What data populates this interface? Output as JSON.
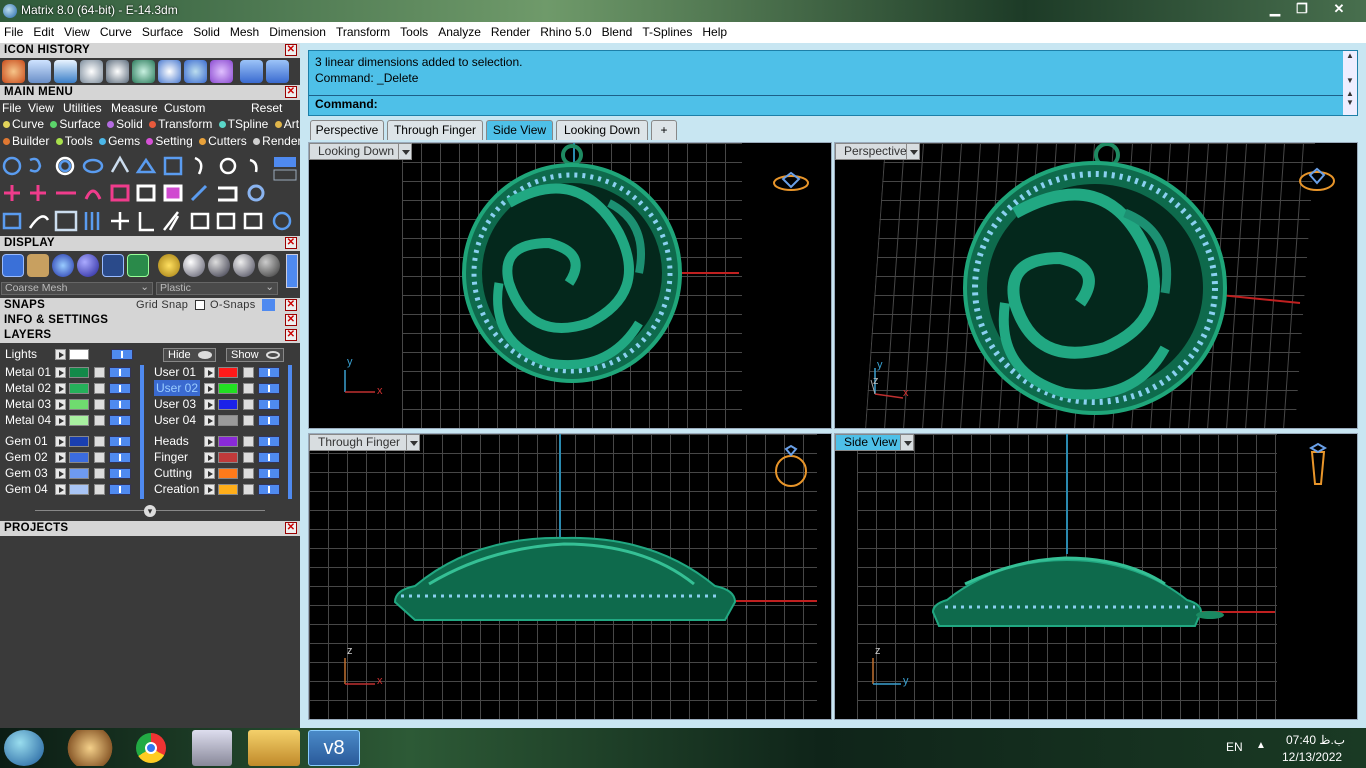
{
  "window": {
    "title": "Matrix 8.0 (64-bit) - E-14.3dm",
    "minimize": "▁",
    "maximize": "❐",
    "close": "✕"
  },
  "menu": [
    "File",
    "Edit",
    "View",
    "Curve",
    "Surface",
    "Solid",
    "Mesh",
    "Dimension",
    "Transform",
    "Tools",
    "Analyze",
    "Render",
    "Rhino 5.0",
    "Blend",
    "T-Splines",
    "Help"
  ],
  "panels": {
    "icon_history": "ICON HISTORY",
    "main_menu": "MAIN MENU",
    "main_menu_items": [
      "File",
      "View",
      "Utilities",
      "Measure",
      "Custom",
      "Reset"
    ],
    "categories_row1": [
      "Curve",
      "Surface",
      "Solid",
      "Transform",
      "TSpline",
      "Art"
    ],
    "categories_row2": [
      "Builder",
      "Tools",
      "Gems",
      "Setting",
      "Cutters",
      "Render"
    ],
    "category_colors": {
      "Curve": "#e3d35a",
      "Surface": "#5bd46a",
      "Solid": "#b36be0",
      "Transform": "#e85a3c",
      "TSpline": "#5ad6c8",
      "Art": "#e0b54a",
      "Builder": "#e07832",
      "Tools": "#a8e04c",
      "Gems": "#4cb7e8",
      "Setting": "#d652d6",
      "Cutters": "#e8a13a",
      "Render": "#d0d0d0"
    },
    "display": "DISPLAY",
    "display_mesh": "Coarse Mesh",
    "display_material": "Plastic",
    "snaps": "SNAPS",
    "grid_snap": "Grid Snap",
    "osnaps": "O-Snaps",
    "info": "INFO & SETTINGS",
    "layers": "LAYERS",
    "projects": "PROJECTS",
    "hide": "Hide",
    "show": "Show"
  },
  "layers_left": [
    {
      "name": "Lights",
      "color": "#ffffff"
    },
    {
      "name": "Metal 01",
      "color": "#138a4a"
    },
    {
      "name": "Metal 02",
      "color": "#25b05a"
    },
    {
      "name": "Metal 03",
      "color": "#6fdc6f"
    },
    {
      "name": "Metal 04",
      "color": "#a8f0a0"
    },
    {
      "name": "Gem 01",
      "color": "#1a3fb0"
    },
    {
      "name": "Gem 02",
      "color": "#3b6ce0"
    },
    {
      "name": "Gem 03",
      "color": "#6e9af0"
    },
    {
      "name": "Gem 04",
      "color": "#a8c4f4"
    }
  ],
  "layers_right": [
    {
      "name": "User 01",
      "color": "#ff1a1a"
    },
    {
      "name": "User 02",
      "color": "#22e022"
    },
    {
      "name": "User 03",
      "color": "#1a22e8"
    },
    {
      "name": "User 04",
      "color": "#9a9a9a"
    },
    {
      "name": "Heads",
      "color": "#8a2ad8"
    },
    {
      "name": "Finger",
      "color": "#c03a3a"
    },
    {
      "name": "Cutting",
      "color": "#ff7a1a"
    },
    {
      "name": "Creation",
      "color": "#ffae1a"
    }
  ],
  "command": {
    "line1": "3 linear dimensions added to selection.",
    "line2": "Command: _Delete",
    "prompt": "Command:"
  },
  "tabs": [
    "Perspective",
    "Through Finger",
    "Side View",
    "Looking Down",
    "+"
  ],
  "viewports": {
    "top_left": {
      "label": "Looking Down",
      "axis1": "y",
      "axis2": "x"
    },
    "top_right": {
      "label": "Perspective",
      "axis1": "y",
      "axis2": "x",
      "axis3": "z"
    },
    "bottom_left": {
      "label": "Through Finger",
      "axis1": "z",
      "axis2": "x"
    },
    "bottom_right": {
      "label": "Side View",
      "axis1": "z",
      "axis2": "y"
    }
  },
  "taskbar": {
    "language": "EN",
    "time": "07:40 ب.ظ",
    "date": "12/13/2022",
    "arrow": "▲",
    "v8": "v8"
  }
}
